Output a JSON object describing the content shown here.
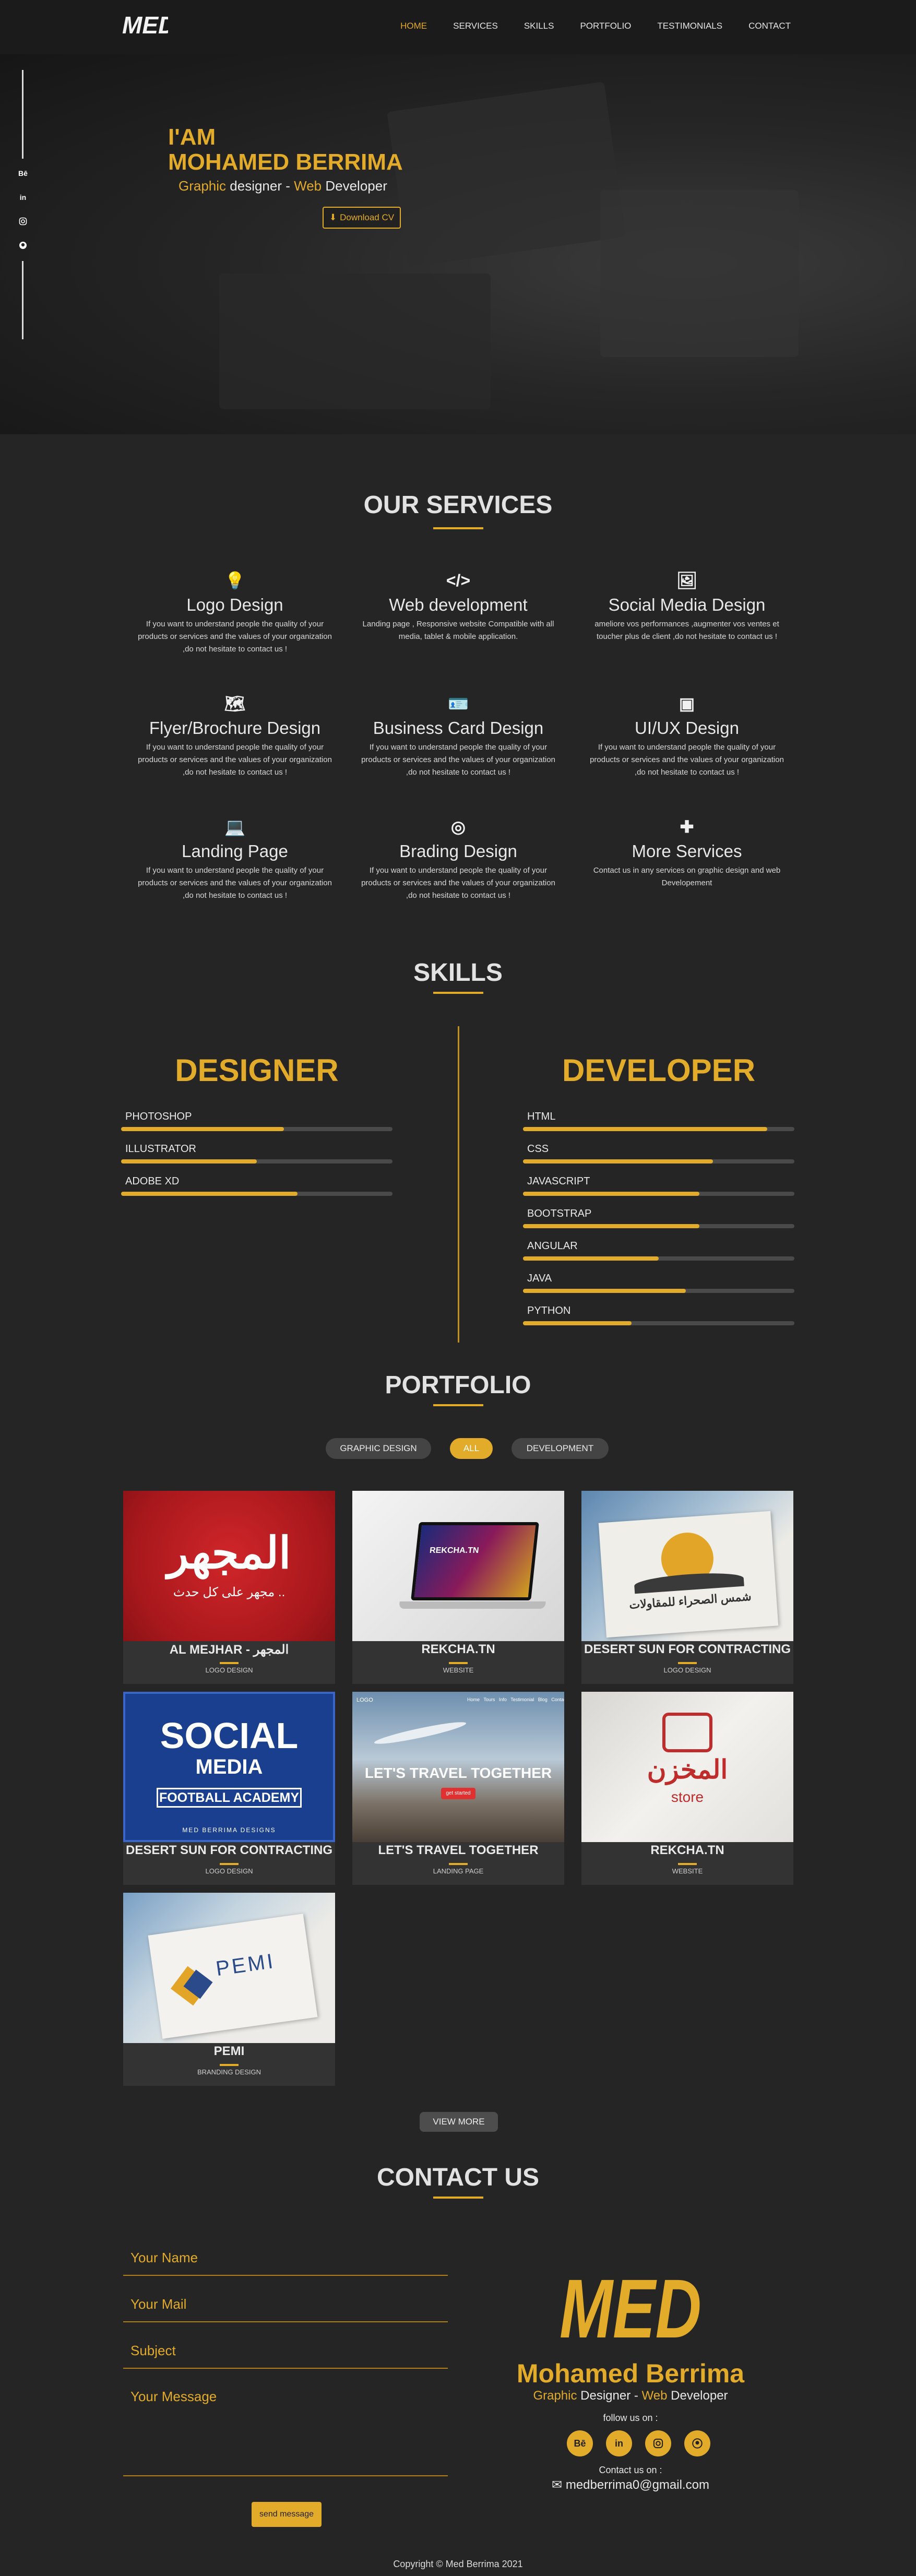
{
  "nav": {
    "logo_text": "MED",
    "items": [
      "HOME",
      "SERVICES",
      "SKILLS",
      "PORTFOLIO",
      "TESTIMONIALS",
      "CONTACT"
    ],
    "active": "HOME"
  },
  "hero": {
    "iam": "I'AM",
    "name": "MOHAMED BERRIMA",
    "role_a": "Graphic",
    "role_b": " designer - ",
    "role_c": "Web",
    "role_d": " Developer",
    "cv_label": "Download CV",
    "social": [
      "Bē",
      "in",
      "instagram-icon",
      "github-icon"
    ]
  },
  "services": {
    "title": "OUR SERVICES",
    "items": [
      {
        "title": "Logo Design",
        "desc": "If you want to understand people the quality of your products or services and the values of your organization ,do not hesitate to contact us !",
        "icon": "lightbulb-icon"
      },
      {
        "title": "Web development",
        "desc": "Landing page , Responsive website Compatible with all media, tablet & mobile application.",
        "icon": "code-icon"
      },
      {
        "title": "Social Media Design",
        "desc": "ameliore vos performances ,augmenter vos ventes et toucher plus de client ,do not hesitate to contact us !",
        "icon": "images-icon"
      },
      {
        "title": "Flyer/Brochure Design",
        "desc": "If you want to understand people the quality of your products or services and the values of your organization ,do not hesitate to contact us !",
        "icon": "map-icon"
      },
      {
        "title": "Business Card Design",
        "desc": "If you want to understand people the quality of your products or services and the values of your organization ,do not hesitate to contact us !",
        "icon": "id-card-icon"
      },
      {
        "title": "UI/UX Design",
        "desc": "If you want to understand people the quality of your products or services and the values of your organization ,do not hesitate to contact us !",
        "icon": "vector-icon"
      },
      {
        "title": "Landing Page",
        "desc": "If you want to understand people the quality of your products or services and the values of your organization ,do not hesitate to contact us !",
        "icon": "laptop-code-icon"
      },
      {
        "title": "Brading Design",
        "desc": "If you want to understand people the quality of your products or services and the values of your organization ,do not hesitate to contact us !",
        "icon": "fingerprint-icon"
      },
      {
        "title": "More Services",
        "desc": "Contact us in any services on graphic design and web Developement",
        "icon": "plus-icon"
      }
    ]
  },
  "skills": {
    "title": "SKILLS",
    "designer": {
      "head": "DESIGNER",
      "items": [
        {
          "name": "PHOTOSHOP",
          "level": 0.6
        },
        {
          "name": "ILLUSTRATOR",
          "level": 0.5
        },
        {
          "name": "ADOBE XD",
          "level": 0.65
        }
      ]
    },
    "developer": {
      "head": "DEVELOPER",
      "items": [
        {
          "name": "HTML",
          "level": 0.9
        },
        {
          "name": "CSS",
          "level": 0.7
        },
        {
          "name": "JAVASCRIPT",
          "level": 0.65
        },
        {
          "name": "BOOTSTRAP",
          "level": 0.65
        },
        {
          "name": "ANGULAR",
          "level": 0.5
        },
        {
          "name": "JAVA",
          "level": 0.6
        },
        {
          "name": "PYTHON",
          "level": 0.4
        }
      ]
    }
  },
  "portfolio": {
    "title": "PORTFOLIO",
    "filters": [
      "GRAPHIC DESIGN",
      "ALL",
      "DEVELOPMENT"
    ],
    "active_filter": "ALL",
    "cards": [
      {
        "title": "AL MEJHAR - المجهر",
        "category": "LOGO DESIGN",
        "img_main": "المجهر",
        "img_sub": "مجهر على كل حدث ..",
        "style": "red"
      },
      {
        "title": "REKCHA.TN",
        "category": "WEBSITE",
        "img_main": "REKCHA.TN",
        "style": "laptop"
      },
      {
        "title": "DESERT SUN FOR CONTRACTING",
        "category": "LOGO DESIGN",
        "img_main": "شمس الصحراء للمقاولات",
        "img_sub": "",
        "style": "desert"
      },
      {
        "title": "DESERT SUN FOR CONTRACTING",
        "category": "LOGO DESIGN",
        "img_main": "SOCIAL",
        "img_sub": "MEDIA",
        "img_sub2": "FOOTBALL ACADEMY",
        "img_sub3": "MED BERRIMA DESIGNS",
        "style": "social"
      },
      {
        "title": "LET'S TRAVEL TOGETHER",
        "category": "LANDING PAGE",
        "img_main": "LET'S TRAVEL TOGETHER",
        "img_sub": "get started",
        "img_sub2": "LOGO",
        "img_sub3": "Home   Tours   Info   Testimonial   Blog   Contact",
        "style": "travel"
      },
      {
        "title": "REKCHA.TN",
        "category": "WEBSITE",
        "img_main": "المخزن",
        "img_sub": "store",
        "style": "store"
      },
      {
        "title": "PEMI",
        "category": "BRANDING DESIGN",
        "img_main": "PEMI",
        "style": "pemi"
      }
    ],
    "view_more": "VIEW MORE"
  },
  "contact": {
    "title": "CONTACT US",
    "name_ph": "Your Name",
    "mail_ph": "Your Mail",
    "subject_ph": "Subject",
    "message_ph": "Your Message",
    "send": "send message",
    "card_logo": "MED",
    "card_name": "Mohamed Berrima",
    "role_a": "Graphic",
    "role_b": " Designer - ",
    "role_c": "Web",
    "role_d": " Developer",
    "follow": "follow us on :",
    "social": [
      "Bē",
      "in",
      "instagram-icon",
      "github-icon"
    ],
    "contact_label": "Contact us on :",
    "email": "medberrima0@gmail.com"
  },
  "footer": {
    "copyright": "Copyright © Med Berrima 2021"
  },
  "colors": {
    "accent": "#e3ab2a",
    "bg": "#252525",
    "nav": "#1b1b1b"
  }
}
